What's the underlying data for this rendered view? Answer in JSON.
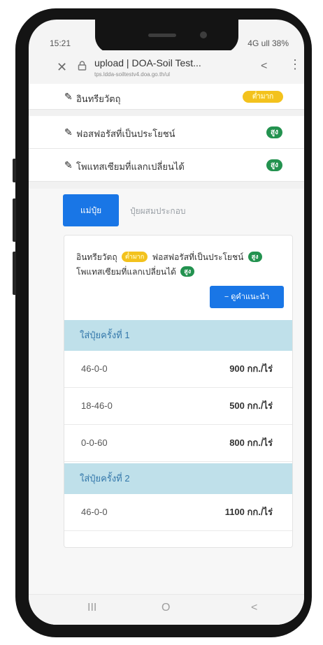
{
  "status": {
    "time": "15:21",
    "right": "4G ull 38%"
  },
  "browser": {
    "title": "upload | DOA-Soil Test...",
    "host": "tps.ldda-soiltestv4.doa.go.th/ul"
  },
  "accordion": [
    {
      "label": "อินทรียวัตถุ",
      "badge": "ต่ำมาก"
    },
    {
      "label": "ฟอสฟอรัสที่เป็นประโยชน์",
      "badge": "สูง"
    },
    {
      "label": "โพแทสเซียมที่แลกเปลี่ยนได้",
      "badge": "สูง"
    }
  ],
  "tabs": {
    "active": "แม่ปุ๋ย",
    "inactive": "ปุ๋ยผสมประกอบ"
  },
  "summary": {
    "om_label": "อินทรียวัตถุ",
    "om_badge": "ต่ำมาก",
    "p_label": "ฟอสฟอรัสที่เป็นประโยชน์",
    "p_badge": "สูง",
    "k_label": "โพแทสเซียมที่แลกเปลี่ยนได้",
    "k_badge": "สูง",
    "button": "− ดูคำแนะนำ"
  },
  "groups": [
    {
      "title": "ใส่ปุ๋ยครั้งที่ 1",
      "rows": [
        {
          "formula": "46-0-0",
          "amount": "900 กก./ไร่"
        },
        {
          "formula": "18-46-0",
          "amount": "500 กก./ไร่"
        },
        {
          "formula": "0-0-60",
          "amount": "800 กก./ไร่"
        }
      ]
    },
    {
      "title": "ใส่ปุ๋ยครั้งที่ 2",
      "rows": [
        {
          "formula": "46-0-0",
          "amount": "1100 กก./ไร่"
        }
      ]
    }
  ],
  "nav": {
    "recent": "III",
    "home": "O",
    "back": "<"
  }
}
